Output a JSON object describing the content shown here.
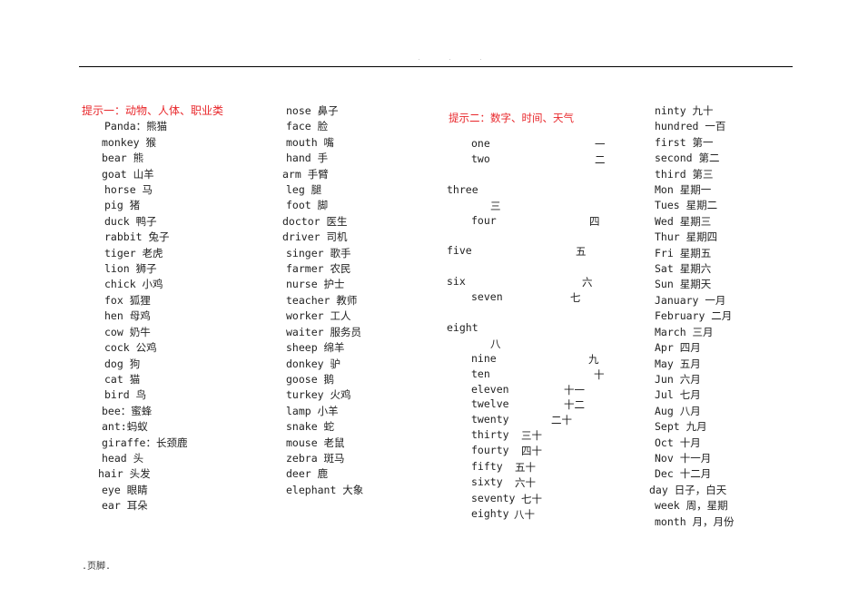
{
  "header": {
    "dots": ". .     ."
  },
  "section1": {
    "heading": "提示一：动物、人体、职业类",
    "col1": [
      "Panda：熊猫",
      "monkey 猴",
      "bear 熊",
      "goat 山羊",
      "horse 马",
      "pig 猪",
      "duck 鸭子",
      "rabbit  兔子",
      "tiger  老虎",
      "lion  狮子",
      "chick 小鸡",
      "fox 狐狸",
      "hen 母鸡",
      "cow 奶牛",
      "cock 公鸡",
      "dog  狗",
      "cat 猫",
      "bird 鸟",
      "bee：蜜蜂",
      "ant:蚂蚁",
      "giraffe：长颈鹿",
      "head 头",
      "hair 头发",
      "eye 眼睛",
      "ear 耳朵"
    ],
    "col2": [
      "nose 鼻子",
      "face 脸",
      "mouth 嘴",
      "hand 手",
      "arm 手臂",
      "leg 腿",
      "foot 脚",
      "doctor 医生",
      "driver 司机",
      "singer 歌手",
      "farmer 农民",
      "nurse 护士",
      "teacher 教师",
      "worker 工人",
      "waiter 服务员",
      "sheep 绵羊",
      "donkey 驴",
      "goose 鹅",
      "turkey 火鸡",
      "lamp 小羊",
      "snake 蛇",
      "mouse 老鼠",
      "zebra 斑马",
      "deer 鹿",
      "elephant 大象"
    ]
  },
  "section2": {
    "heading": "提示二：数字、时间、天气",
    "numbers": [
      {
        "en": "one",
        "zh": "一"
      },
      {
        "en": "two",
        "zh": "二"
      },
      {
        "en": "three",
        "zh": "三"
      },
      {
        "en": "four",
        "zh": "四"
      },
      {
        "en": "five",
        "zh": "五"
      },
      {
        "en": "six",
        "zh": "六"
      },
      {
        "en": "seven",
        "zh": "七"
      },
      {
        "en": "eight",
        "zh": "八"
      },
      {
        "en": "nine",
        "zh": "九"
      },
      {
        "en": "ten",
        "zh": "十"
      },
      {
        "en": "eleven",
        "zh": "十一"
      },
      {
        "en": "twelve",
        "zh": "十二"
      },
      {
        "en": "twenty",
        "zh": "二十"
      },
      {
        "en": "thirty",
        "zh": "三十"
      },
      {
        "en": "fourty",
        "zh": "四十"
      },
      {
        "en": "fifty",
        "zh": "五十"
      },
      {
        "en": "sixty",
        "zh": "六十"
      },
      {
        "en": "seventy",
        "zh": "七十"
      },
      {
        "en": "eighty",
        "zh": "八十"
      }
    ],
    "col4": [
      "ninty 九十",
      "hundred 一百",
      "first 第一",
      "second 第二",
      "third 第三",
      "Mon 星期一",
      "Tues 星期二",
      "Wed 星期三",
      "Thur 星期四",
      "Fri 星期五",
      "Sat 星期六",
      "Sun 星期天",
      "January 一月",
      "February 二月",
      "March 三月",
      "Apr 四月",
      "May 五月",
      "Jun 六月",
      "Jul 七月",
      "Aug 八月",
      "Sept 九月",
      "Oct 十月",
      "Nov 十一月",
      "Dec 十二月",
      "day 日子，白天",
      "week 周，星期",
      "month 月，月份"
    ]
  },
  "footer": {
    "text": ".页脚."
  }
}
